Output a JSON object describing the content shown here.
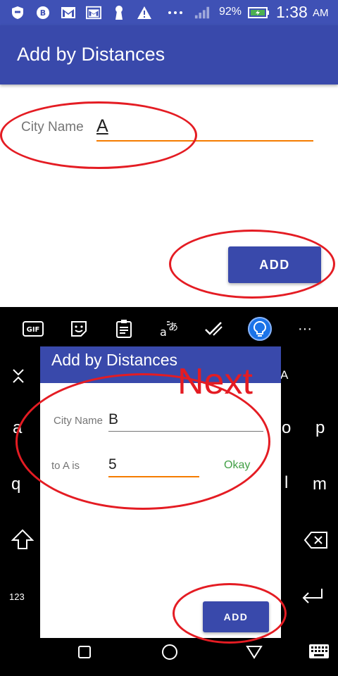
{
  "status_bar": {
    "battery_percent": "92%",
    "time": "1:38",
    "ampm": "AM",
    "icons": [
      "shield-icon",
      "bitcoin-icon",
      "gmail-icon",
      "gmail-icon",
      "keyhole-icon",
      "warning-icon",
      "more-icon",
      "signal-icon",
      "battery-charging-icon"
    ]
  },
  "app_bar": {
    "title": "Add by Distances"
  },
  "form": {
    "city_label": "City Name",
    "city_value": "A",
    "add_label": "ADD"
  },
  "keyboard": {
    "toolbar_icons": [
      "gif-icon",
      "sticker-icon",
      "clipboard-icon",
      "translate-icon",
      "checklist-icon",
      "lightbulb-icon",
      "more-icon"
    ],
    "gif_label": "GIF",
    "more_label": "···",
    "keys": {
      "a": "a",
      "o": "o",
      "p": "p",
      "q": "q",
      "l": "l",
      "m": "m",
      "A": "A",
      "num": "123"
    }
  },
  "popup": {
    "title": "Add by Distances",
    "city_label": "City Name",
    "city_value": "B",
    "distance_label": "to A is",
    "distance_value": "5",
    "okay_label": "Okay",
    "add_label": "ADD"
  },
  "annotation": {
    "next_text": "Next"
  },
  "colors": {
    "primary": "#3949ab",
    "status": "#3f51b5",
    "accent": "#f57c00",
    "okay_green": "#43a047",
    "annotation_red": "#e41c23"
  }
}
